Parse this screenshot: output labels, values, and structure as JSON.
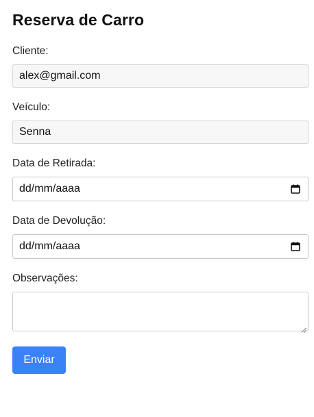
{
  "page": {
    "title": "Reserva de Carro"
  },
  "form": {
    "cliente": {
      "label": "Cliente:",
      "value": "alex@gmail.com"
    },
    "veiculo": {
      "label": "Veículo:",
      "value": "Senna"
    },
    "data_retirada": {
      "label": "Data de Retirada:",
      "placeholder": "dd/mm/aaaa",
      "icon": "calendar-icon"
    },
    "data_devolucao": {
      "label": "Data de Devolução:",
      "placeholder": "dd/mm/aaaa",
      "icon": "calendar-icon"
    },
    "observacoes": {
      "label": "Observações:",
      "value": ""
    },
    "submit": {
      "label": "Enviar",
      "color": "#3b82f6"
    }
  }
}
